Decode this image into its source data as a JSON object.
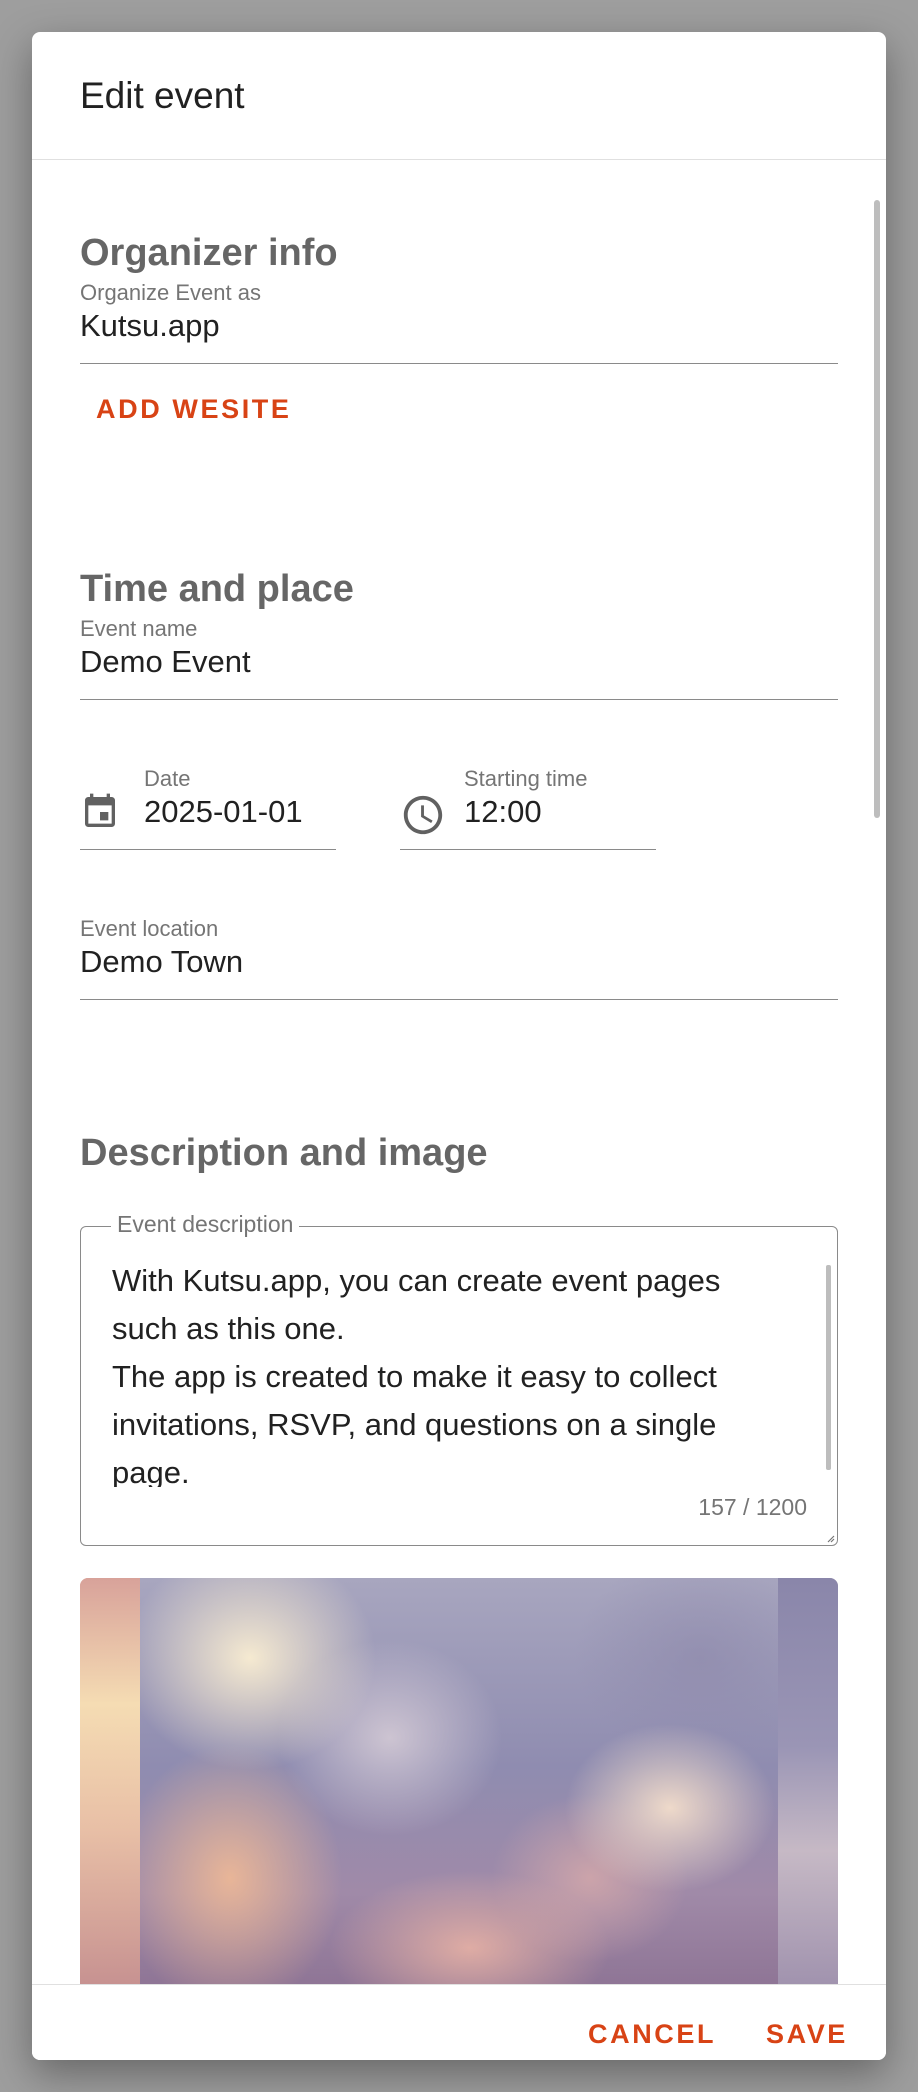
{
  "dialog": {
    "title": "Edit event"
  },
  "organizer": {
    "heading": "Organizer info",
    "organize_as_label": "Organize Event as",
    "organize_as_value": "Kutsu.app",
    "add_website_label": "ADD WESITE"
  },
  "time_place": {
    "heading": "Time and place",
    "event_name_label": "Event name",
    "event_name_value": "Demo Event",
    "date_label": "Date",
    "date_value": "2025-01-01",
    "date_icon": "calendar-icon",
    "time_label": "Starting time",
    "time_value": "12:00",
    "time_icon": "clock-icon",
    "location_label": "Event location",
    "location_value": "Demo Town"
  },
  "description": {
    "heading": "Description and image",
    "label": "Event description",
    "text": "With Kutsu.app, you can create event pages such as this one.\nThe app is created to make it easy to collect invitations, RSVP, and questions on a single page.",
    "counter": "157 / 1200"
  },
  "actions": {
    "cancel_label": "CANCEL",
    "save_label": "SAVE"
  },
  "colors": {
    "accent": "#d84315",
    "overlay": "#9e9e9e"
  }
}
